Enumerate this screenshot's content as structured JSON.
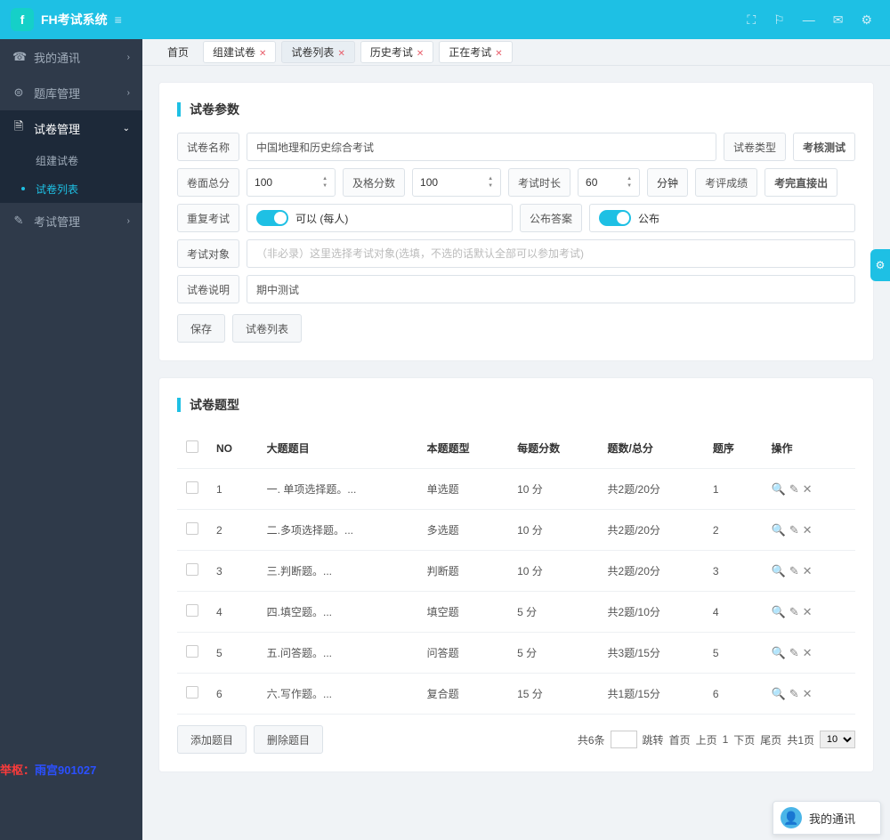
{
  "app": {
    "title": "FH考试系统"
  },
  "top_icons": [
    "⛶",
    "⚐",
    "—",
    "✉",
    "⚙"
  ],
  "sidebar": {
    "items": [
      {
        "icon": "☎",
        "label": "我的通讯",
        "chev": "›"
      },
      {
        "icon": "⊜",
        "label": "题库管理",
        "chev": "›"
      },
      {
        "icon": "🗎",
        "label": "试卷管理",
        "chev": "⌄",
        "active": true
      },
      {
        "icon": "✎",
        "label": "考试管理",
        "chev": "›"
      }
    ],
    "subs": [
      {
        "label": "组建试卷"
      },
      {
        "label": "试卷列表",
        "sel": true
      }
    ]
  },
  "tabs": [
    {
      "label": "首页",
      "home": true
    },
    {
      "label": "组建试卷",
      "close": true
    },
    {
      "label": "试卷列表",
      "close": true,
      "active": true
    },
    {
      "label": "历史考试",
      "close": true
    },
    {
      "label": "正在考试",
      "close": true
    }
  ],
  "panel1": {
    "title": "试卷参数",
    "labels": {
      "name": "试卷名称",
      "type": "试卷类型",
      "type_val": "考核测试",
      "total": "卷面总分",
      "pass": "及格分数",
      "duration": "考试时长",
      "minute": "分钟",
      "score_rule": "考评成绩",
      "score_rule_val": "考完直接出",
      "repeat": "重复考试",
      "repeat_val": "可以 (每人)",
      "publish_ans": "公布答案",
      "publish_val": "公布",
      "target": "考试对象",
      "target_ph": "（非必录）这里选择考试对象(选填，不选的话默认全部可以参加考试)",
      "desc": "试卷说明"
    },
    "values": {
      "name": "中国地理和历史综合考试",
      "total": "100",
      "pass": "100",
      "duration": "60",
      "desc": "期中测试"
    },
    "btns": {
      "save": "保存",
      "list": "试卷列表"
    }
  },
  "panel2": {
    "title": "试卷题型",
    "headers": [
      "",
      "NO",
      "大题题目",
      "本题题型",
      "每题分数",
      "题数/总分",
      "题序",
      "操作"
    ],
    "rows": [
      {
        "no": "1",
        "title": "一. 单项选择题。...",
        "type": "单选题",
        "score": "10 分",
        "count": "共2题/20分",
        "order": "1"
      },
      {
        "no": "2",
        "title": "二.多项选择题。...",
        "type": "多选题",
        "score": "10 分",
        "count": "共2题/20分",
        "order": "2"
      },
      {
        "no": "3",
        "title": "三.判断题。...",
        "type": "判断题",
        "score": "10 分",
        "count": "共2题/20分",
        "order": "3"
      },
      {
        "no": "4",
        "title": "四.填空题。...",
        "type": "填空题",
        "score": "5 分",
        "count": "共2题/10分",
        "order": "4"
      },
      {
        "no": "5",
        "title": "五.问答题。...",
        "type": "问答题",
        "score": "5 分",
        "count": "共3题/15分",
        "order": "5"
      },
      {
        "no": "6",
        "title": "六.写作题。...",
        "type": "复合题",
        "score": "15 分",
        "count": "共1题/15分",
        "order": "6"
      }
    ],
    "btns": {
      "add": "添加题目",
      "del": "删除题目"
    },
    "pager": {
      "total": "共6条",
      "jump": "跳转",
      "first": "首页",
      "prev": "上页",
      "page": "1",
      "next": "下页",
      "last": "尾页",
      "of": "共1页",
      "size": "10"
    }
  },
  "watermark": {
    "a": "举枢：",
    "b": "雨宫901027"
  },
  "chat": "我的通讯"
}
